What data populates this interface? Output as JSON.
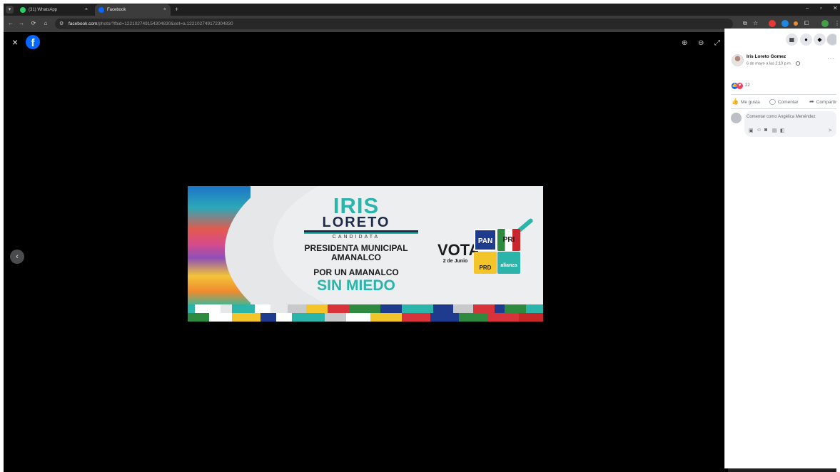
{
  "browser": {
    "tabs": [
      {
        "title": "(31) WhatsApp",
        "favicon_color": "#25d366",
        "active": false
      },
      {
        "title": "Facebook",
        "favicon_color": "#0866ff",
        "active": true
      }
    ],
    "new_tab_glyph": "+",
    "close_glyph": "×",
    "window_controls": {
      "minimize": "–",
      "maximize": "▫",
      "close": "✕"
    },
    "nav": {
      "back": "←",
      "forward": "→",
      "reload": "⟳",
      "home": "⌂",
      "tune": "⚙"
    },
    "url_host": "facebook.com",
    "url_path": "/photo/?fbid=122102749154304830&set=a.122102749172304830",
    "toolbar_icons": [
      "cast-icon",
      "star-icon",
      "extensions-icon",
      "menu-icon"
    ],
    "extension_colors": [
      "#e53935",
      "#1e88e5",
      "#e53935",
      "#43a047"
    ]
  },
  "viewer": {
    "close_glyph": "×",
    "logo_glyph": "f",
    "zoom_in_glyph": "⊕",
    "zoom_out_glyph": "⊖",
    "fullscreen_glyph": "⤢",
    "prev_glyph": "‹",
    "banner": {
      "name": "IRIS",
      "surname": "LORETO",
      "candidate": "CANDIDATA",
      "office_line1": "PRESIDENTA MUNICIPAL",
      "office_line2": "AMANALCO",
      "slogan_line1": "POR UN AMANALCO",
      "slogan_line2": "SIN MIEDO",
      "vote": "VOTA",
      "vote_date": "2 de Junio",
      "parties": [
        "PAN",
        "PRI",
        "PRD",
        "alianza"
      ],
      "colors": {
        "teal": "#2bb5aa",
        "navy": "#1e2a4a"
      }
    }
  },
  "sidebar": {
    "top_icons": [
      "apps-icon",
      "messenger-icon",
      "notifications-icon"
    ],
    "author": "Iris Loreto Gomez",
    "date": "6 de mayo a las 2:10 p.m. ·",
    "more_glyph": "···",
    "reaction_count": "22",
    "actions": {
      "like": "Me gusta",
      "comment": "Comentar",
      "share": "Compartir"
    },
    "comment_placeholder": "Comentar como Angélica Menéndez",
    "comment_tools": [
      "sticker-icon",
      "emoji-icon",
      "camera-icon",
      "gif-icon",
      "avatar-sticker-icon"
    ],
    "send_glyph": "➤"
  }
}
